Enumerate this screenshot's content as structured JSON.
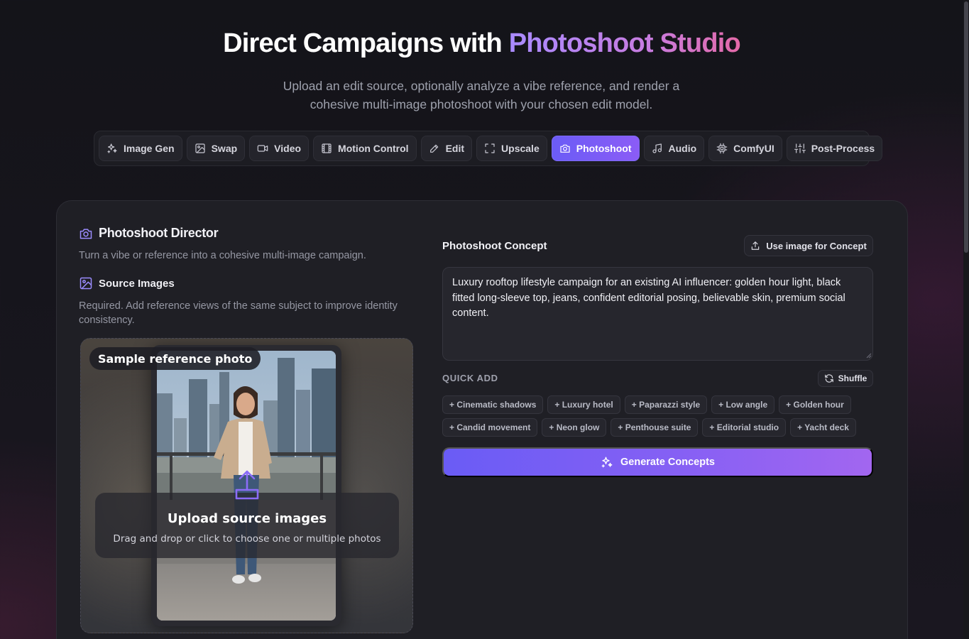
{
  "hero": {
    "title_main": "Direct Campaigns with ",
    "title_accent": "Photoshoot Studio",
    "subtitle": "Upload an edit source, optionally analyze a vibe reference, and render a cohesive multi-image photoshoot with your chosen edit model."
  },
  "nav": {
    "tabs": [
      {
        "label": "Image Gen",
        "icon": "sparkles-icon"
      },
      {
        "label": "Swap",
        "icon": "image-icon"
      },
      {
        "label": "Video",
        "icon": "video-icon"
      },
      {
        "label": "Motion Control",
        "icon": "film-icon"
      },
      {
        "label": "Edit",
        "icon": "pencil-icon"
      },
      {
        "label": "Upscale",
        "icon": "expand-icon"
      },
      {
        "label": "Photoshoot",
        "icon": "camera-icon",
        "active": true
      },
      {
        "label": "Audio",
        "icon": "music-icon"
      },
      {
        "label": "ComfyUI",
        "icon": "chip-icon"
      },
      {
        "label": "Post-Process",
        "icon": "sliders-icon"
      }
    ]
  },
  "director": {
    "title": "Photoshoot Director",
    "subtitle": "Turn a vibe or reference into a cohesive multi-image campaign."
  },
  "source": {
    "title": "Source Images",
    "subtitle": "Required. Add reference views of the same subject to improve identity consistency.",
    "sample_badge": "Sample reference photo",
    "upload_title": "Upload source images",
    "upload_sub": "Drag and drop or click to choose one or multiple photos"
  },
  "concept": {
    "label": "Photoshoot Concept",
    "use_image_label": "Use image for Concept",
    "text": "Luxury rooftop lifestyle campaign for an existing AI influencer: golden hour light, black fitted long-sleeve top, jeans, confident editorial posing, believable skin, premium social content."
  },
  "quick_add": {
    "label": "QUICK ADD",
    "shuffle_label": "Shuffle",
    "chips": [
      "+ Cinematic shadows",
      "+ Luxury hotel",
      "+ Paparazzi style",
      "+ Low angle",
      "+ Golden hour",
      "+ Candid movement",
      "+ Neon glow",
      "+ Penthouse suite",
      "+ Editorial studio",
      "+ Yacht deck"
    ]
  },
  "generate": {
    "label": "Generate Concepts"
  },
  "colors": {
    "accent": "#7c5cf6",
    "accent_pink": "#e46aa8",
    "panel": "#1f1f25"
  }
}
